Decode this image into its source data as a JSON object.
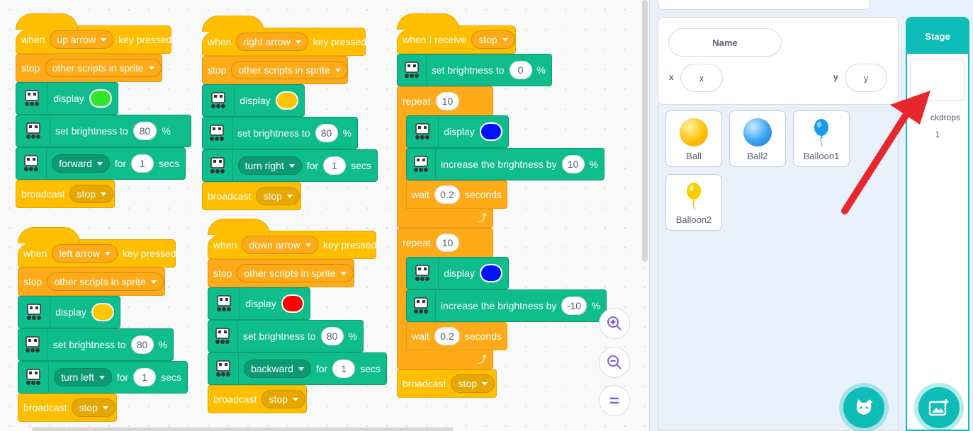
{
  "colors": {
    "events": "#ffbf00",
    "control": "#ffab19",
    "extension": "#0fbd8c",
    "accent": "#0fbdb8",
    "annotation": "#e8262d"
  },
  "scripts": {
    "s1": {
      "when": "when",
      "key_dropdown": "up arrow",
      "key_pressed": "key pressed",
      "stop": "stop",
      "stop_option": "other scripts in sprite",
      "display": "display",
      "display_color": "#33e62c",
      "set_brightness": "set brightness to",
      "brightness_value": "80",
      "percent": "%",
      "move_dropdown": "forward",
      "for": "for",
      "secs_value": "1",
      "secs": "secs",
      "broadcast": "broadcast",
      "broadcast_msg": "stop"
    },
    "s2": {
      "when": "when",
      "key_dropdown": "right arrow",
      "key_pressed": "key pressed",
      "stop": "stop",
      "stop_option": "other scripts in sprite",
      "display": "display",
      "display_color": "#ffc500",
      "set_brightness": "set brightness to",
      "brightness_value": "80",
      "percent": "%",
      "move_dropdown": "turn right",
      "for": "for",
      "secs_value": "1",
      "secs": "secs",
      "broadcast": "broadcast",
      "broadcast_msg": "stop"
    },
    "s3": {
      "when": "when",
      "key_dropdown": "left arrow",
      "key_pressed": "key pressed",
      "stop": "stop",
      "stop_option": "other scripts in sprite",
      "display": "display",
      "display_color": "#ffc500",
      "set_brightness": "set brightness to",
      "brightness_value": "80",
      "percent": "%",
      "move_dropdown": "turn left",
      "for": "for",
      "secs_value": "1",
      "secs": "secs",
      "broadcast": "broadcast",
      "broadcast_msg": "stop"
    },
    "s4": {
      "when": "when",
      "key_dropdown": "down arrow",
      "key_pressed": "key pressed",
      "stop": "stop",
      "stop_option": "other scripts in sprite",
      "display": "display",
      "display_color": "#ff0000",
      "set_brightness": "set brightness to",
      "brightness_value": "80",
      "percent": "%",
      "move_dropdown": "backward",
      "for": "for",
      "secs_value": "1",
      "secs": "secs",
      "broadcast": "broadcast",
      "broadcast_msg": "stop"
    },
    "s5": {
      "when_receive": "when I receive",
      "receive_msg": "stop",
      "set_brightness": "set brightness to",
      "brightness_value": "0",
      "percent": "%",
      "repeat": "repeat",
      "repeat1_value": "10",
      "display": "display",
      "display_color": "#0011ff",
      "increase_brightness": "increase the brightness by",
      "inc1_value": "10",
      "wait": "wait",
      "wait1_value": "0.2",
      "seconds": "seconds",
      "repeat2_value": "10",
      "inc2_value": "-10",
      "wait2_value": "0.2",
      "broadcast": "broadcast",
      "broadcast_msg": "stop"
    }
  },
  "sprite_info": {
    "name_placeholder": "Name",
    "x_label": "x",
    "x_placeholder": "x",
    "y_label": "y",
    "y_placeholder": "y"
  },
  "sprites": [
    {
      "name": "Ball",
      "icon": "yellow-ball-icon"
    },
    {
      "name": "Ball2",
      "icon": "blue-ball-icon"
    },
    {
      "name": "Balloon1",
      "icon": "blue-balloon-icon"
    },
    {
      "name": "Balloon2",
      "icon": "yellow-balloon-icon"
    }
  ],
  "stage": {
    "title": "Stage",
    "backdrops_label": "ckdrops",
    "backdrops_count": "1"
  }
}
